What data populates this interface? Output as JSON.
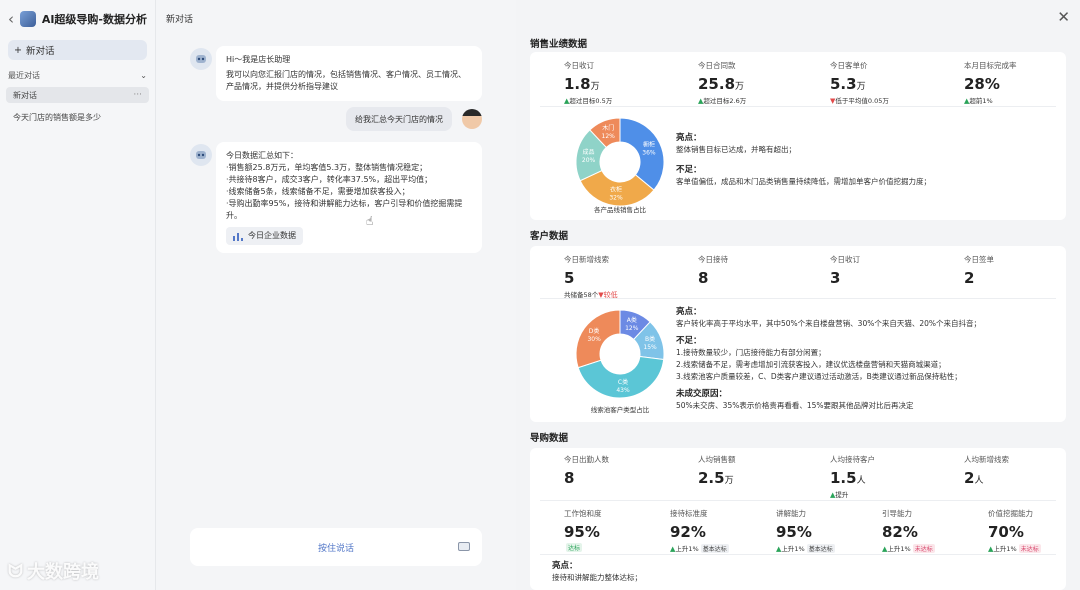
{
  "sidebar": {
    "title": "AI超级导购-数据分析",
    "new_chat": "新对话",
    "recent_label": "最近对话",
    "conversations": [
      "新对话",
      "今天门店的销售额是多少"
    ]
  },
  "chat": {
    "title": "新对话",
    "greeting_title": "Hi～我是店长助理",
    "greeting_body": "我可以向您汇报门店的情况，包括销售情况、客户情况、员工情况、产品情况，并提供分析指导建议",
    "user_message": "给我汇总今天门店的情况",
    "summary_title": "今日数据汇总如下：",
    "summary_lines": [
      "·销售额25.8万元，单均客值5.3万，整体销售情况稳定；",
      "·共接待8客户，成交3客户，转化率37.5%，超出平均值；",
      "·线索储备5条，线索储备不足，需要增加获客投入；",
      "·导购出勤率95%，接待和讲解能力达标，客户引导和价值挖掘需提升。"
    ],
    "data_button": "今日企业数据",
    "voice_button": "按住说话"
  },
  "watermark": "大数跨境",
  "panel": {
    "sales": {
      "title": "销售业绩数据",
      "stats": [
        {
          "label": "今日收订",
          "value": "1.8",
          "unit": "万",
          "dir": "up",
          "sub": "超过目标0.5万"
        },
        {
          "label": "今日合同款",
          "value": "25.8",
          "unit": "万",
          "dir": "up",
          "sub": "超过目标2.6万"
        },
        {
          "label": "今日客单价",
          "value": "5.3",
          "unit": "万",
          "dir": "down",
          "sub": "低于平均值0.05万"
        },
        {
          "label": "本月目标完成率",
          "value": "28%",
          "unit": "",
          "dir": "up",
          "sub": "超前1%"
        }
      ],
      "chart": {
        "caption": "各产品线销售占比",
        "slices": [
          {
            "name": "橱柜",
            "value": 36,
            "color": "#4f8fe8"
          },
          {
            "name": "衣柜",
            "value": 32,
            "color": "#f0a94a"
          },
          {
            "name": "成品",
            "value": 20,
            "color": "#8fd3c8"
          },
          {
            "name": "木门",
            "value": 12,
            "color": "#ee8a5a"
          }
        ]
      },
      "highlight_title": "亮点：",
      "highlight": "整体销售目标已达成，并略有超出；",
      "weak_title": "不足：",
      "weak": "客单值偏低，成品和木门品类销售量持续降低，需增加单客户价值挖掘力度；"
    },
    "customers": {
      "title": "客户数据",
      "stats": [
        {
          "label": "今日新增线索",
          "value": "5",
          "sub": "共储备58个",
          "dir": "down",
          "sub2": "较低"
        },
        {
          "label": "今日接待",
          "value": "8"
        },
        {
          "label": "今日收订",
          "value": "3"
        },
        {
          "label": "今日签单",
          "value": "2"
        }
      ],
      "chart": {
        "caption": "线索池客户类型占比",
        "slices": [
          {
            "name": "A类",
            "value": 12,
            "color": "#6c8ae4"
          },
          {
            "name": "B类",
            "value": 15,
            "color": "#7fc3e8"
          },
          {
            "name": "C类",
            "value": 43,
            "color": "#5bc6d6"
          },
          {
            "name": "D类",
            "value": 30,
            "color": "#ee8a5a"
          }
        ]
      },
      "highlight_title": "亮点：",
      "highlight": "客户转化率高于平均水平，其中50%个来自楼盘营销、30%个来自天猫、20%个来自抖音；",
      "weak_title": "不足：",
      "weak_lines": [
        "1.接待数量较少，门店接待能力有部分闲置；",
        "2.线索储备不足，需考虑增加引流获客投入，建议优选楼盘营销和天猫商城渠道；",
        "3.线索池客户质量较差，C、D类客户建议通过活动激活，B类建议通过新品保持粘性；"
      ],
      "reason_title": "未成交原因：",
      "reason": "50%未交房、35%表示价格贵再看看、15%要跟其他品牌对比后再决定"
    },
    "guides": {
      "title": "导购数据",
      "stats": [
        {
          "label": "今日出勤人数",
          "value": "8",
          "unit": ""
        },
        {
          "label": "人均销售额",
          "value": "2.5",
          "unit": "万"
        },
        {
          "label": "人均接待客户",
          "value": "1.5",
          "unit": "人",
          "dir": "up",
          "sub": "提升"
        },
        {
          "label": "人均新增线索",
          "value": "2",
          "unit": "人"
        }
      ],
      "abilities": [
        {
          "label": "工作饱和度",
          "value": "95%",
          "badge": "达标",
          "btype": "g"
        },
        {
          "label": "接待标准度",
          "value": "92%",
          "sub": "上升1%",
          "badge": "基本达标",
          "btype": "n"
        },
        {
          "label": "讲解能力",
          "value": "95%",
          "sub": "上升1%",
          "badge": "基本达标",
          "btype": "n"
        },
        {
          "label": "引导能力",
          "value": "82%",
          "sub": "上升1%",
          "badge": "未达标",
          "btype": "r"
        },
        {
          "label": "价值挖掘能力",
          "value": "70%",
          "sub": "上升1%",
          "badge": "未达标",
          "btype": "r"
        }
      ],
      "highlight_title": "亮点：",
      "highlight": "接待和讲解能力整体达标；"
    }
  }
}
